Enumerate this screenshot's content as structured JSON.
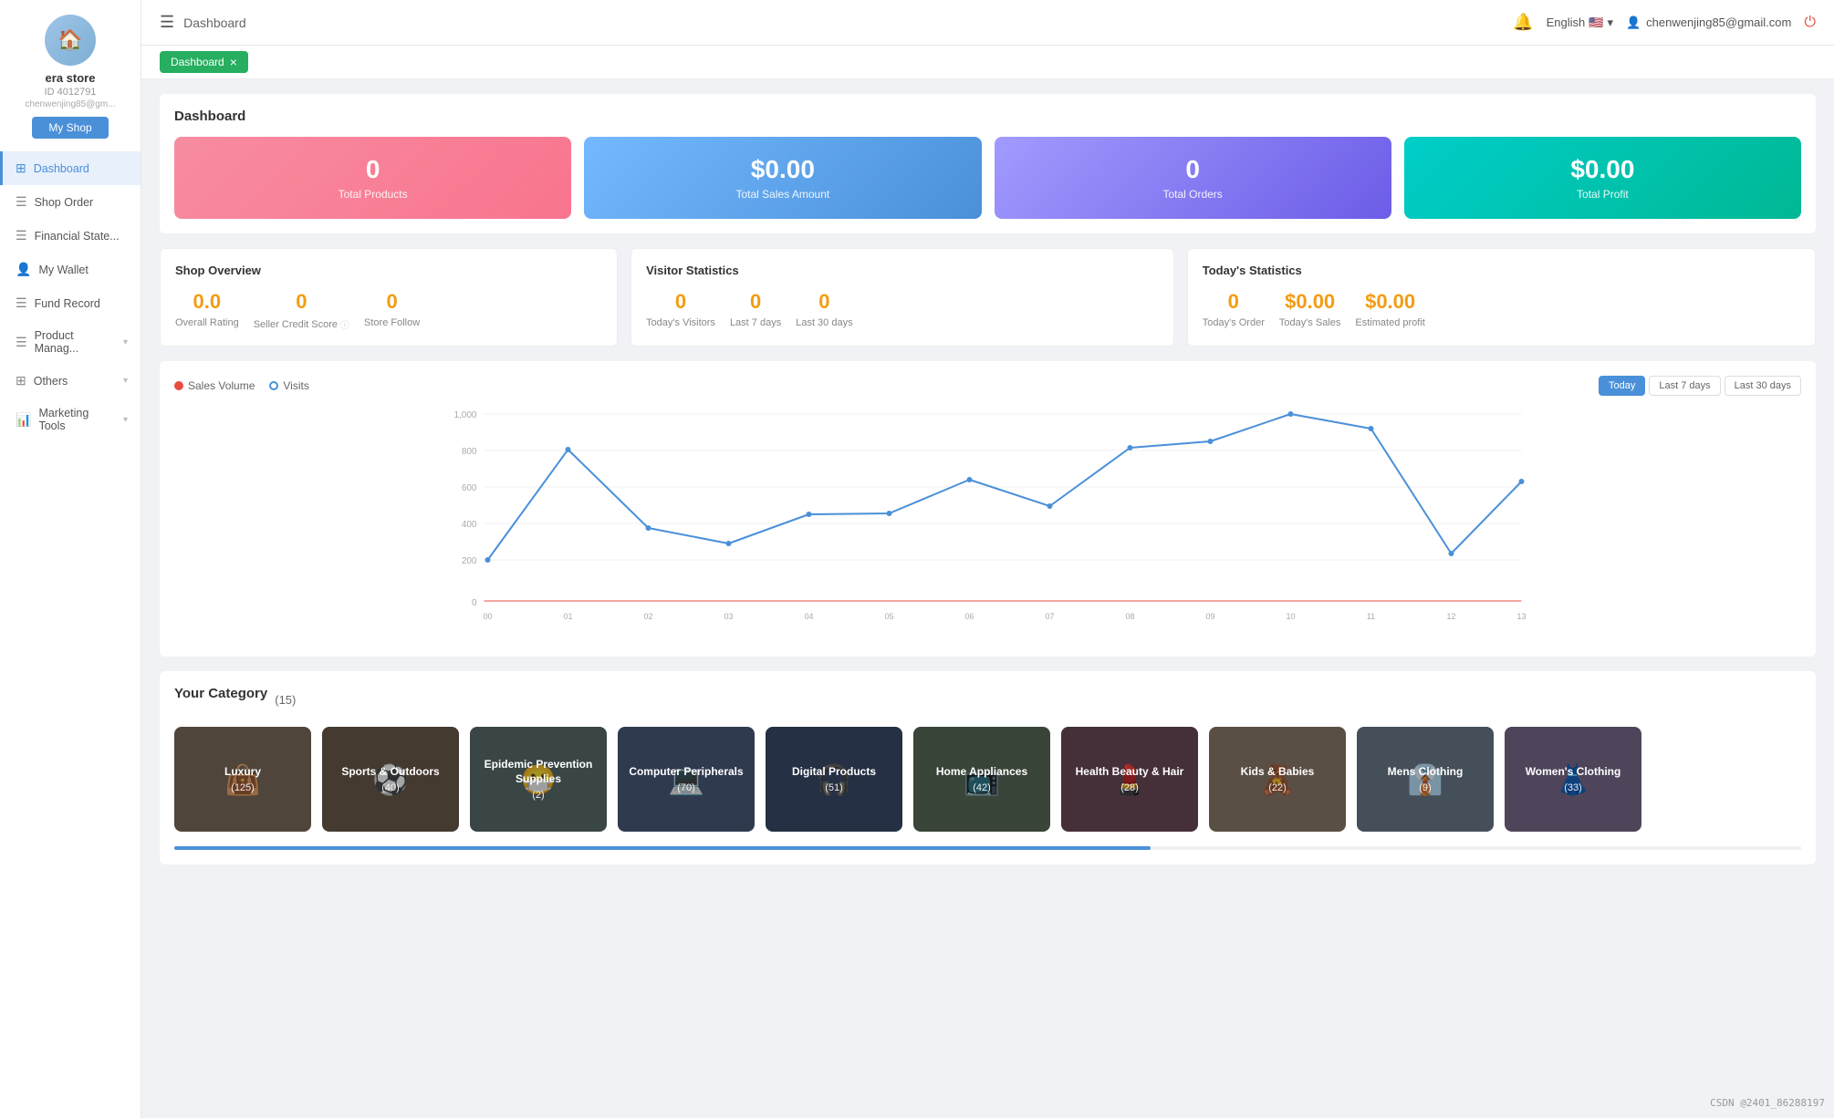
{
  "sidebar": {
    "avatar_emoji": "🏠",
    "store_name": "era store",
    "store_id": "ID 4012791",
    "store_email": "chenwenjing85@gm...",
    "myshop_btn": "My Shop",
    "nav_items": [
      {
        "id": "dashboard",
        "label": "Dashboard",
        "icon": "⊞",
        "active": true,
        "has_chevron": false
      },
      {
        "id": "shop-order",
        "label": "Shop Order",
        "icon": "☰",
        "active": false,
        "has_chevron": false
      },
      {
        "id": "financial",
        "label": "Financial State...",
        "icon": "☰",
        "active": false,
        "has_chevron": false
      },
      {
        "id": "my-wallet",
        "label": "My Wallet",
        "icon": "👤",
        "active": false,
        "has_chevron": false
      },
      {
        "id": "fund-record",
        "label": "Fund Record",
        "icon": "☰",
        "active": false,
        "has_chevron": false
      },
      {
        "id": "product-manag",
        "label": "Product Manag...",
        "icon": "☰",
        "active": false,
        "has_chevron": true
      },
      {
        "id": "others",
        "label": "Others",
        "icon": "⊞",
        "active": false,
        "has_chevron": true
      },
      {
        "id": "marketing-tools",
        "label": "Marketing Tools",
        "icon": "📊",
        "active": false,
        "has_chevron": true
      }
    ]
  },
  "topbar": {
    "hamburger_icon": "☰",
    "title": "Dashboard",
    "bell_icon": "🔔",
    "lang_label": "English",
    "flag_emoji": "🇺🇸",
    "user_icon": "👤",
    "user_email": "chenwenjing85@gmail.com",
    "logout_icon": "⏻"
  },
  "breadcrumb": {
    "tab_label": "Dashboard",
    "close_icon": "×"
  },
  "dashboard": {
    "title": "Dashboard",
    "stat_cards": [
      {
        "id": "total-products",
        "value": "0",
        "label": "Total Products",
        "color_class": "pink"
      },
      {
        "id": "total-sales",
        "value": "$0.00",
        "label": "Total Sales Amount",
        "color_class": "blue"
      },
      {
        "id": "total-orders",
        "value": "0",
        "label": "Total Orders",
        "color_class": "purple"
      },
      {
        "id": "total-profit",
        "value": "$0.00",
        "label": "Total Profit",
        "color_class": "teal"
      }
    ]
  },
  "shop_overview": {
    "title": "Shop Overview",
    "metrics": [
      {
        "id": "overall-rating",
        "value": "0.0",
        "label": "Overall Rating",
        "has_info": false
      },
      {
        "id": "seller-credit",
        "value": "0",
        "label": "Seller Credit Score",
        "has_info": true
      },
      {
        "id": "store-follow",
        "value": "0",
        "label": "Store Follow",
        "has_info": false
      }
    ]
  },
  "visitor_stats": {
    "title": "Visitor Statistics",
    "metrics": [
      {
        "id": "todays-visitors",
        "value": "0",
        "label": "Today's Visitors"
      },
      {
        "id": "last-7-days",
        "value": "0",
        "label": "Last 7 days"
      },
      {
        "id": "last-30-days",
        "value": "0",
        "label": "Last 30 days"
      }
    ]
  },
  "todays_stats": {
    "title": "Today's Statistics",
    "metrics": [
      {
        "id": "todays-order",
        "value": "0",
        "label": "Today's Order",
        "is_money": false
      },
      {
        "id": "todays-sales",
        "value": "$0.00",
        "label": "Today's Sales",
        "is_money": true
      },
      {
        "id": "estimated-profit",
        "value": "$0.00",
        "label": "Estimated profit",
        "is_money": true
      }
    ]
  },
  "chart": {
    "title": "Sales Volume / Visits",
    "legend": {
      "sales_label": "Sales Volume",
      "visits_label": "Visits"
    },
    "time_buttons": [
      {
        "id": "today",
        "label": "Today",
        "active": true
      },
      {
        "id": "last-7-days",
        "label": "Last 7 days",
        "active": false
      },
      {
        "id": "last-30-days",
        "label": "Last 30 days",
        "active": false
      }
    ],
    "y_labels": [
      "1,000",
      "800",
      "600",
      "400",
      "200",
      "0"
    ],
    "x_labels": [
      "00",
      "01",
      "02",
      "03",
      "04",
      "05",
      "06",
      "07",
      "08",
      "09",
      "10",
      "11",
      "12",
      "13"
    ],
    "visits_points": [
      [
        0,
        220
      ],
      [
        1,
        810
      ],
      [
        2,
        390
      ],
      [
        3,
        310
      ],
      [
        4,
        465
      ],
      [
        5,
        470
      ],
      [
        6,
        650
      ],
      [
        7,
        510
      ],
      [
        8,
        820
      ],
      [
        9,
        855
      ],
      [
        10,
        1050
      ],
      [
        11,
        920
      ],
      [
        12,
        255
      ],
      [
        13,
        640
      ]
    ]
  },
  "category": {
    "title": "Your Category",
    "count": 15,
    "items": [
      {
        "id": "luxury",
        "name": "Luxury",
        "count": "(125)",
        "color": "#7a6a5a",
        "emoji": "👜"
      },
      {
        "id": "sports-outdoors",
        "name": "Sports & Outdoors",
        "count": "(40)",
        "color": "#8a6a4a",
        "emoji": "⚽"
      },
      {
        "id": "epidemic",
        "name": "Epidemic Prevention Supplies",
        "count": "(2)",
        "color": "#5a6a6a",
        "emoji": "😷"
      },
      {
        "id": "computer-peripherals",
        "name": "Computer Peripherals",
        "count": "(70)",
        "color": "#4a5a7a",
        "emoji": "💻"
      },
      {
        "id": "digital-products",
        "name": "Digital Products",
        "count": "(51)",
        "color": "#3a4a6a",
        "emoji": "🎧"
      },
      {
        "id": "home-appliances",
        "name": "Home Appliances",
        "count": "(42)",
        "color": "#5a6a5a",
        "emoji": "📺"
      },
      {
        "id": "health-beauty",
        "name": "Health Beauty & Hair",
        "count": "(28)",
        "color": "#6a4a5a",
        "emoji": "💄"
      },
      {
        "id": "kids-babies",
        "name": "Kids & Babies",
        "count": "(22)",
        "color": "#8a7a6a",
        "emoji": "🧸"
      },
      {
        "id": "mens-clothing",
        "name": "Mens Clothing",
        "count": "(9)",
        "color": "#6a7a8a",
        "emoji": "👔"
      },
      {
        "id": "womens-clothing",
        "name": "Women's Clothing",
        "count": "(33)",
        "color": "#7a6a8a",
        "emoji": "👗"
      }
    ]
  },
  "watermark": "CSDN @2401_86288197"
}
